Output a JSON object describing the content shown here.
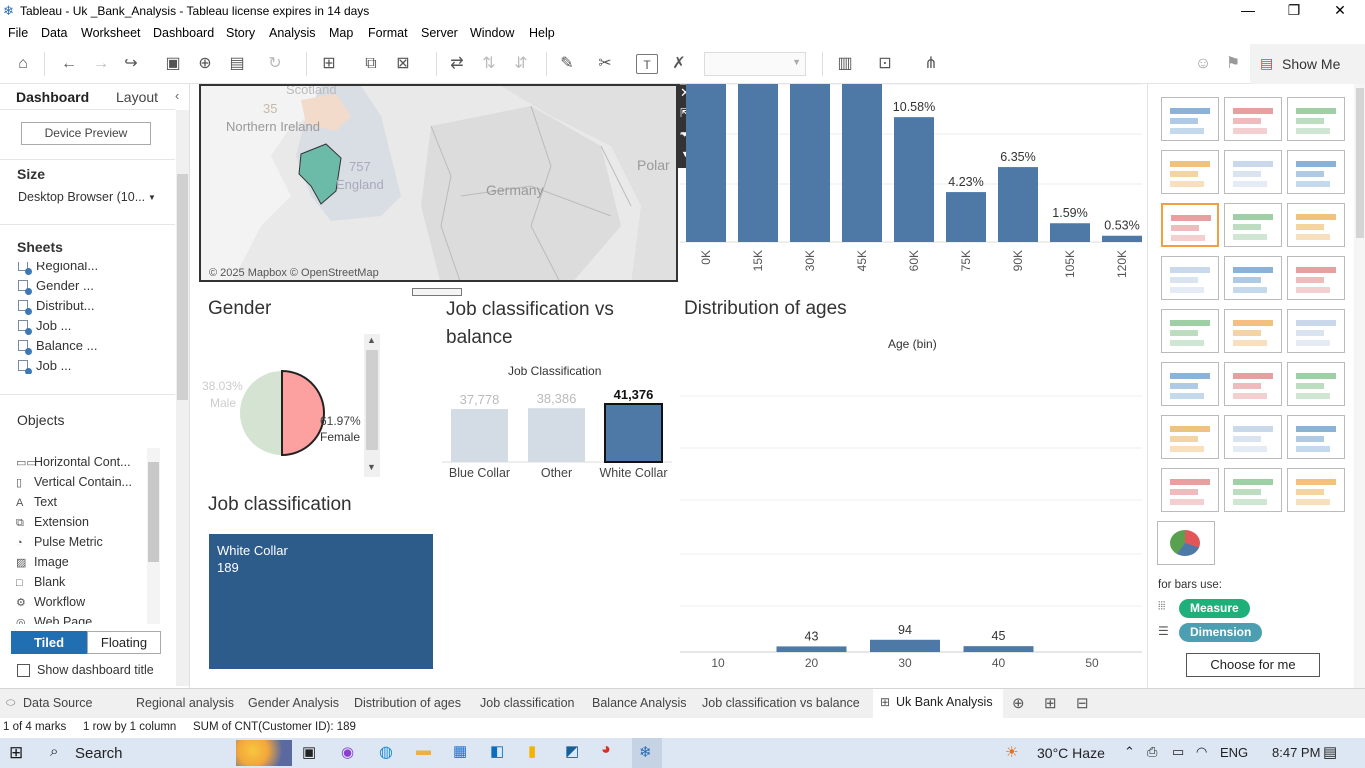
{
  "window": {
    "title": "Tableau - Uk _Bank_Analysis - Tableau license expires in 14 days"
  },
  "menu": [
    "File",
    "Data",
    "Worksheet",
    "Dashboard",
    "Story",
    "Analysis",
    "Map",
    "Format",
    "Server",
    "Window",
    "Help"
  ],
  "toolbar": {
    "show_me": "Show Me"
  },
  "leftpane": {
    "tab_dashboard": "Dashboard",
    "tab_layout": "Layout",
    "device_preview": "Device Preview",
    "size_label": "Size",
    "size_value": "Desktop Browser (10...",
    "sheets_label": "Sheets",
    "sheets": [
      "Regional...",
      "Gender ...",
      "Distribut...",
      "Job ...",
      "Balance ...",
      "Job ..."
    ],
    "objects_label": "Objects",
    "objects": [
      {
        "icon": "▭▭",
        "label": "Horizontal Cont..."
      },
      {
        "icon": "▯",
        "label": "Vertical Contain..."
      },
      {
        "icon": "A",
        "label": "Text"
      },
      {
        "icon": "⧉",
        "label": "Extension"
      },
      {
        "icon": "◔",
        "label": "Pulse Metric"
      },
      {
        "icon": "▨",
        "label": "Image"
      },
      {
        "icon": "□",
        "label": "Blank"
      },
      {
        "icon": "⚙",
        "label": "Workflow"
      },
      {
        "icon": "◎",
        "label": "Web Page"
      }
    ],
    "tiled": "Tiled",
    "floating": "Floating",
    "show_title": "Show dashboard title"
  },
  "map": {
    "labels": {
      "scotland": "Scotland",
      "ni": "Northern Ireland",
      "england": "England",
      "germany": "Germany",
      "poland": "Polar",
      "v35": "35",
      "v757": "757"
    },
    "credit": "© 2025 Mapbox © OpenStreetMap"
  },
  "balance_hist": {
    "categories": [
      "0K",
      "15K",
      "30K",
      "45K",
      "60K",
      "75K",
      "90K",
      "105K",
      "120K"
    ],
    "labels": [
      "",
      "",
      "",
      "",
      "10.58%",
      "4.23%",
      "6.35%",
      "1.59%",
      "0.53%"
    ]
  },
  "gender": {
    "title": "Gender",
    "male_label": "Male",
    "male_pct": "38.03%",
    "female_label": "Female",
    "female_pct": "61.97%"
  },
  "jobbal": {
    "title": "Job classification vs balance",
    "header": "Job Classification",
    "bars": [
      {
        "label": "Blue Collar",
        "value": "37,778"
      },
      {
        "label": "Other",
        "value": "38,386"
      },
      {
        "label": "White Collar",
        "value": "41,376"
      }
    ]
  },
  "jobclass": {
    "title": "Job classification",
    "label": "White Collar",
    "value": "189"
  },
  "ages": {
    "title": "Distribution of ages",
    "header": "Age (bin)",
    "ticks": [
      "10",
      "20",
      "30",
      "40",
      "50"
    ],
    "bars": [
      {
        "value": "43"
      },
      {
        "value": "94"
      },
      {
        "value": "45"
      }
    ]
  },
  "showme": {
    "for_bars": "for bars use:",
    "measure": "Measure",
    "dimension": "Dimension",
    "choose": "Choose for me"
  },
  "tabs": [
    "Data Source",
    "Regional analysis",
    "Gender Analysis",
    "Distribution of ages",
    "Job classification",
    "Balance Analysis",
    "Job classification vs balance",
    "Uk Bank Analysis"
  ],
  "status": {
    "marks": "1 of 4 marks",
    "rows": "1 row by 1 column",
    "sum": "SUM of CNT(Customer ID): 189"
  },
  "taskbar": {
    "search": "Search",
    "weather": "30°C  Haze",
    "lang": "ENG",
    "time": "8:47 PM"
  },
  "chart_data": [
    {
      "type": "bar",
      "title": "",
      "categories": [
        "0K",
        "15K",
        "30K",
        "45K",
        "60K",
        "75K",
        "90K",
        "105K",
        "120K"
      ],
      "values": [
        null,
        null,
        null,
        null,
        10.58,
        4.23,
        6.35,
        1.59,
        0.53
      ],
      "ylabel": ""
    },
    {
      "type": "pie",
      "title": "Gender",
      "categories": [
        "Male",
        "Female"
      ],
      "values": [
        38.03,
        61.97
      ]
    },
    {
      "type": "bar",
      "title": "Job classification vs balance",
      "categories": [
        "Blue Collar",
        "Other",
        "White Collar"
      ],
      "values": [
        37778,
        38386,
        41376
      ]
    },
    {
      "type": "bar",
      "title": "Distribution of ages",
      "xlabel": "Age (bin)",
      "x": [
        20,
        30,
        40
      ],
      "values": [
        43,
        94,
        45
      ]
    }
  ]
}
